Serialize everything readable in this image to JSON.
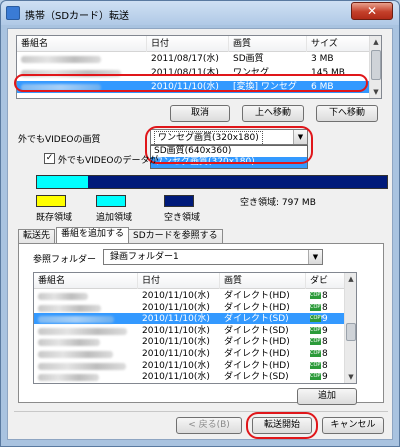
{
  "window": {
    "title": "携帯（SDカード）転送",
    "close_glyph": "✕"
  },
  "top_list": {
    "columns": [
      "番組名",
      "日付",
      "画質",
      "サイズ"
    ],
    "rows": [
      {
        "name": "",
        "date": "2011/08/17(水)",
        "quality": "SD画質",
        "size": "3 MB",
        "selected": false
      },
      {
        "name": "",
        "date": "2011/08/11(木)",
        "quality": "ワンセグ",
        "size": "145 MB",
        "selected": false
      },
      {
        "name": "",
        "date": "2010/11/10(水)",
        "quality": "[変換] ワンセグ",
        "size": "6 MB",
        "selected": true
      }
    ]
  },
  "top_buttons": {
    "cancel": "取消",
    "move_up": "上へ移動",
    "move_down": "下へ移動"
  },
  "outside_video": {
    "label": "外でもVIDEOの画質",
    "selected": "ワンセグ画質(320x180)",
    "options": [
      "SD画質(640x360)",
      "ワンセグ画質(320x180)"
    ],
    "highlighted_index": 1
  },
  "checkbox": {
    "label": "外でもVIDEOのデータが",
    "checked": true
  },
  "capacity": {
    "existing_label": "既存領域",
    "added_label": "追加領域",
    "free_label": "空き領域",
    "free_text": "空き領域: 797 MB",
    "existing_fraction": 0.147,
    "added_fraction": 0.0,
    "colors": {
      "existing": "#ffff00",
      "added": "#00ffff",
      "free": "#001a7a"
    }
  },
  "tabs": [
    "転送先",
    "番組を追加する",
    "SDカードを参照する"
  ],
  "active_tab_index": 1,
  "ref_folder": {
    "label": "参照フォルダー",
    "value": "録画フォルダー1"
  },
  "bottom_list": {
    "columns": [
      "番組名",
      "日付",
      "画質",
      "ダビ"
    ],
    "rows": [
      {
        "name": "",
        "date": "2010/11/10(水)",
        "quality": "ダイレクト(HD)",
        "dub": "8",
        "selected": false
      },
      {
        "name": "",
        "date": "2010/11/10(水)",
        "quality": "ダイレクト(HD)",
        "dub": "8",
        "selected": false
      },
      {
        "name": "",
        "date": "2010/11/10(水)",
        "quality": "ダイレクト(SD)",
        "dub": "9",
        "selected": true
      },
      {
        "name": "",
        "date": "2010/11/10(水)",
        "quality": "ダイレクト(SD)",
        "dub": "9",
        "selected": false
      },
      {
        "name": "",
        "date": "2010/11/10(水)",
        "quality": "ダイレクト(HD)",
        "dub": "8",
        "selected": false
      },
      {
        "name": "",
        "date": "2010/11/10(水)",
        "quality": "ダイレクト(HD)",
        "dub": "8",
        "selected": false
      },
      {
        "name": "",
        "date": "2010/11/10(水)",
        "quality": "ダイレクト(HD)",
        "dub": "8",
        "selected": false
      },
      {
        "name": "",
        "date": "2010/11/10(水)",
        "quality": "ダイレクト(SD)",
        "dub": "9",
        "selected": false
      }
    ],
    "badge_text": "COPY"
  },
  "add_button": "追加",
  "footer": {
    "back": "< 戻る(B)",
    "start": "転送開始",
    "cancel": "キャンセル"
  }
}
